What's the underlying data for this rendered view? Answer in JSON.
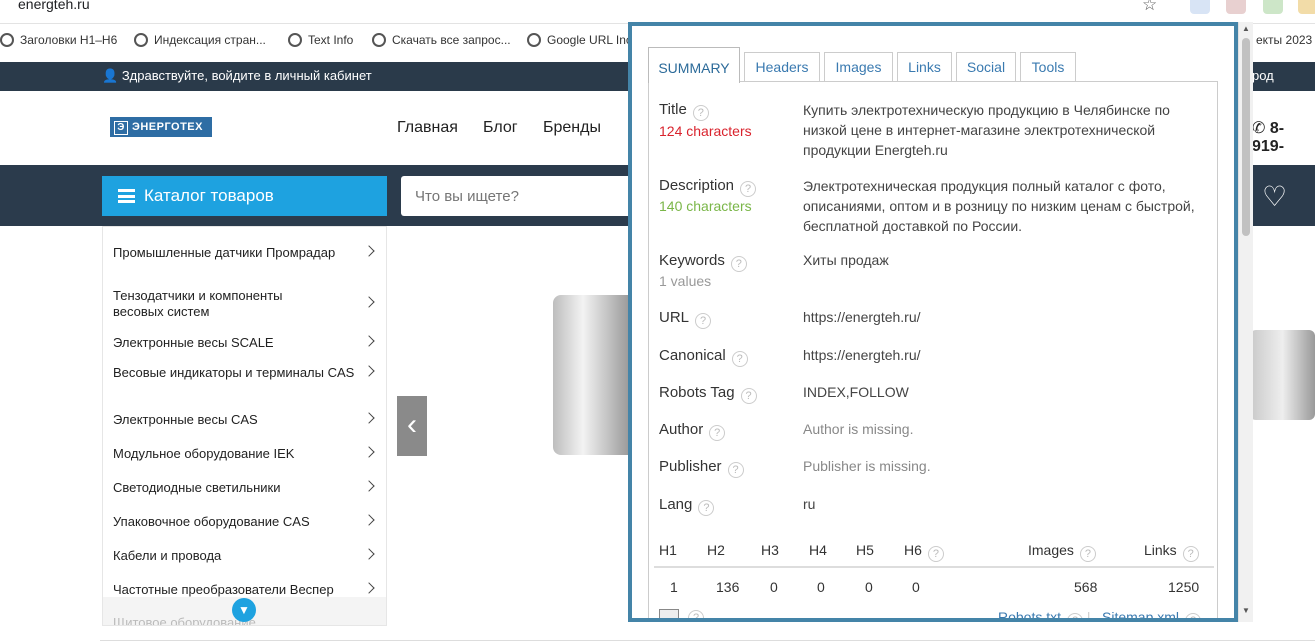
{
  "browser": {
    "url": "energteh.ru",
    "bookmarks": [
      "Заголовки H1–H6",
      "Индексация стран...",
      "Text Info",
      "Скачать все запрос...",
      "Google URL Inc"
    ],
    "bookmark_right": "екты 2023"
  },
  "site": {
    "greeting": "Здравствуйте, войдите в личный кабинет",
    "city": "род",
    "logo_text": "ЭНЕРГОТЕХ",
    "nav": [
      "Главная",
      "Блог",
      "Бренды"
    ],
    "phone": "8-919-",
    "catalog_label": "Каталог товаров",
    "search_placeholder": "Что вы ищете?",
    "menu_items": [
      "Промышленные датчики Промрадар",
      "Тензодатчики и компоненты весовых систем",
      "Электронные весы SCALE",
      "Весовые индикаторы и терминалы CAS",
      "Электронные весы CAS",
      "Модульное оборудование IEK",
      "Светодиодные светильники",
      "Упаковочное оборудование CAS",
      "Кабели и провода",
      "Частотные преобразователи Веспер",
      "Щитовое оборудование"
    ]
  },
  "seo": {
    "tabs": [
      "SUMMARY",
      "Headers",
      "Images",
      "Links",
      "Social",
      "Tools"
    ],
    "title_label": "Title",
    "title_count": "124 characters",
    "title_value": "Купить электротехническую продукцию в Челябинске по низкой цене в интернет-магазине электротехнической продукции Energteh.ru",
    "description_label": "Description",
    "description_count": "140 characters",
    "description_value": "Электротехническая продукция полный каталог с фото, описаниями, оптом и в розницу по низким ценам с быстрой, бесплатной доставкой по России.",
    "keywords_label": "Keywords",
    "keywords_count": "1 values",
    "keywords_value": "Хиты продаж",
    "url_label": "URL",
    "url_value": "https://energteh.ru/",
    "canonical_label": "Canonical",
    "canonical_value": "https://energteh.ru/",
    "robots_label": "Robots Tag",
    "robots_value": "INDEX,FOLLOW",
    "author_label": "Author",
    "author_value": "Author is missing.",
    "publisher_label": "Publisher",
    "publisher_value": "Publisher is missing.",
    "lang_label": "Lang",
    "lang_value": "ru",
    "headings": {
      "h1_label": "H1",
      "h2_label": "H2",
      "h3_label": "H3",
      "h4_label": "H4",
      "h5_label": "H5",
      "h6_label": "H6",
      "images_label": "Images",
      "links_label": "Links",
      "h1": "1",
      "h2": "136",
      "h3": "0",
      "h4": "0",
      "h5": "0",
      "h6": "0",
      "images": "568",
      "links": "1250"
    },
    "robots_link": "Robots.txt",
    "sitemap_link": "Sitemap.xml",
    "help_glyph": "?",
    "colors": {
      "warn": "#d9232d",
      "ok": "#7ab648",
      "border": "#4484a8"
    }
  }
}
